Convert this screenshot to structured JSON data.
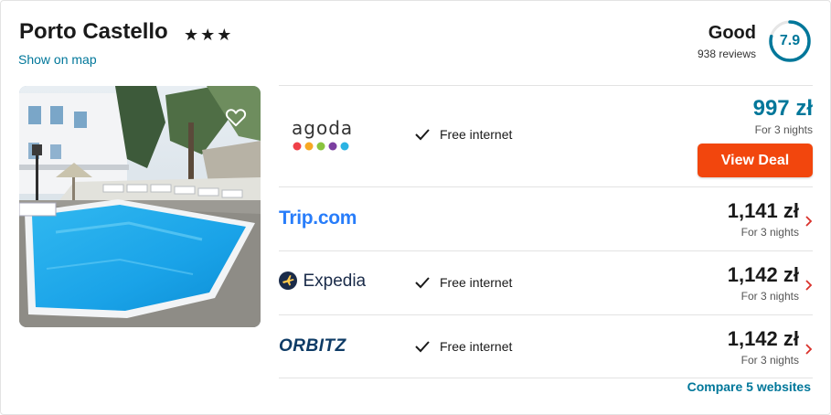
{
  "hotel": {
    "name": "Porto Castello",
    "stars": "★★★",
    "show_on_map": "Show on map"
  },
  "rating": {
    "label": "Good",
    "reviews": "938 reviews",
    "score": "7.9",
    "score_fraction": 0.79,
    "ring_color": "#00779a"
  },
  "photo": {
    "icon": "heart-outline-icon"
  },
  "offers": [
    {
      "provider": "agoda",
      "feature": "Free internet",
      "price": "997 zł",
      "nights": "For 3 nights",
      "cta": "View Deal"
    },
    {
      "provider": "Trip.com",
      "feature": "",
      "price": "1,141 zł",
      "nights": "For 3 nights"
    },
    {
      "provider": "Expedia",
      "feature": "Free internet",
      "price": "1,142 zł",
      "nights": "For 3 nights"
    },
    {
      "provider": "ORBITZ",
      "feature": "Free internet",
      "price": "1,142 zł",
      "nights": "For 3 nights"
    }
  ],
  "compare": "Compare 5 websites",
  "colors": {
    "accent": "#00779a",
    "cta": "#f2460d",
    "chevron": "#d9312b"
  }
}
